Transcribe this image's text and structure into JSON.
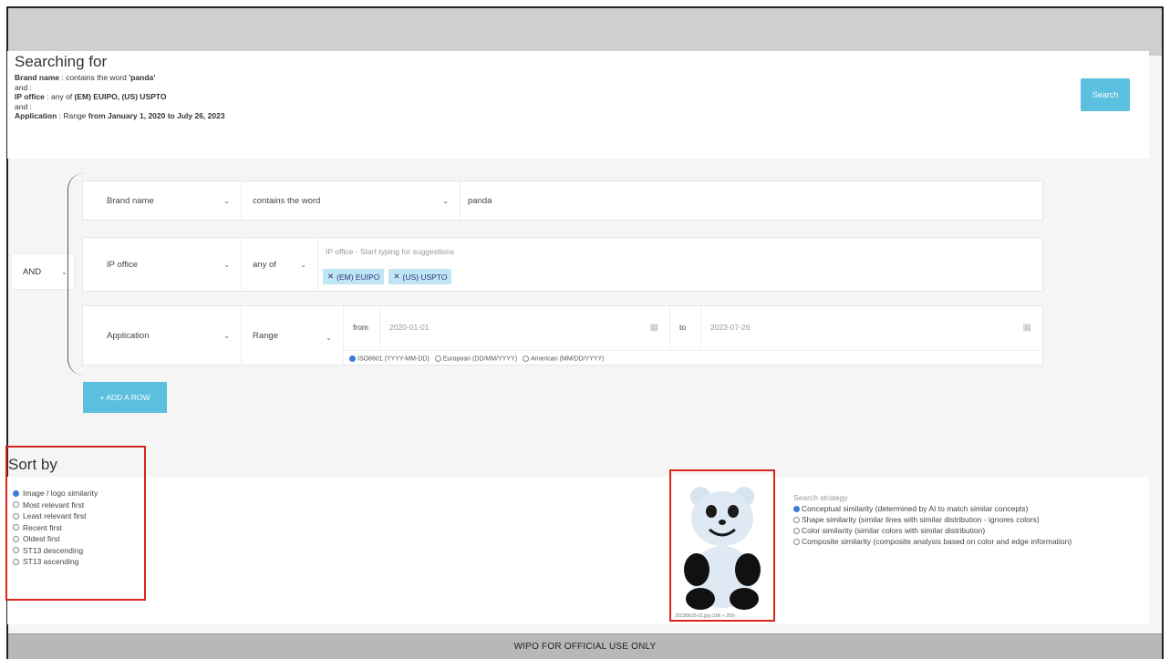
{
  "summary": {
    "title": "Searching for",
    "line1_label": "Brand name",
    "line1_text": " : contains the word ",
    "line1_value": "'panda'",
    "and1": "and :",
    "line2_label": "IP office",
    "line2_text": " : any of ",
    "line2_value": "(EM) EUIPO, (US) USPTO",
    "and2": "and :",
    "line3_label": "Application",
    "line3_text": " : Range ",
    "line3_value": "from January 1, 2020 to July 26, 2023",
    "search_label": "Search"
  },
  "builder": {
    "operator": "AND",
    "row1": {
      "field": "Brand name",
      "condition": "contains the word",
      "value": "panda"
    },
    "row2": {
      "field": "IP office",
      "condition": "any of",
      "placeholder": "IP office - Start typing for suggestions",
      "chips": [
        "(EM) EUIPO",
        "(US) USPTO"
      ]
    },
    "row3": {
      "field": "Application",
      "condition": "Range",
      "from_label": "from",
      "from_value": "2020-01-01",
      "to_label": "to",
      "to_value": "2023-07-26",
      "formats": [
        "ISO8601 (YYYY-MM-DD)",
        "European (DD/MM/YYYY)",
        "American (MM/DD/YYYY)"
      ],
      "selected_format": 0
    },
    "add_row_label": "+ ADD A ROW"
  },
  "sort": {
    "title": "Sort by",
    "options": [
      "Image / logo similarity",
      "Most relevant first",
      "Least relevant first",
      "Recent first",
      "Oldest first",
      "ST13 descending",
      "ST13 ascending"
    ],
    "selected": 0
  },
  "image": {
    "caption": "2023/0625-01.jpg (196 × 250)"
  },
  "strategy": {
    "title": "Search strategy",
    "options": [
      "Conceptual similarity (determined by AI to match similar concepts)",
      "Shape similarity (similar lines with similar distribution - ignores colors)",
      "Color similarity (similar colors with similar distribution)",
      "Composite similarity (composite analysis based on color and edge information)"
    ],
    "selected": 0
  },
  "footer": {
    "text": "WIPO FOR OFFICIAL USE ONLY"
  },
  "colors": {
    "accent": "#5bc0de",
    "highlight": "#d9261c",
    "chip": "#bfe6f5"
  }
}
